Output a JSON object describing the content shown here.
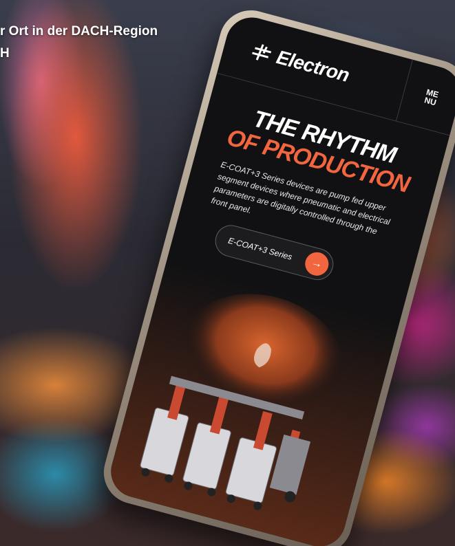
{
  "headline": {
    "line1": "r Ort in der DACH-Region",
    "line2": "H"
  },
  "phone": {
    "brand": "Electron",
    "menu_line1": "ME",
    "menu_line2": "NU",
    "hero_line1": "THE RHYTHM",
    "hero_line2": "OF PRODUCTION",
    "description": "E-COAT+3 Series devices are pump fed upper segment devices where pneumatic and electrical parameters are digitally controlled through the front panel.",
    "cta_label": "E-COAT+3 Series",
    "cta_icon": "arrow-right-icon"
  },
  "colors": {
    "accent": "#f2663f",
    "screen_bg": "#111113",
    "text": "#ffffff"
  }
}
